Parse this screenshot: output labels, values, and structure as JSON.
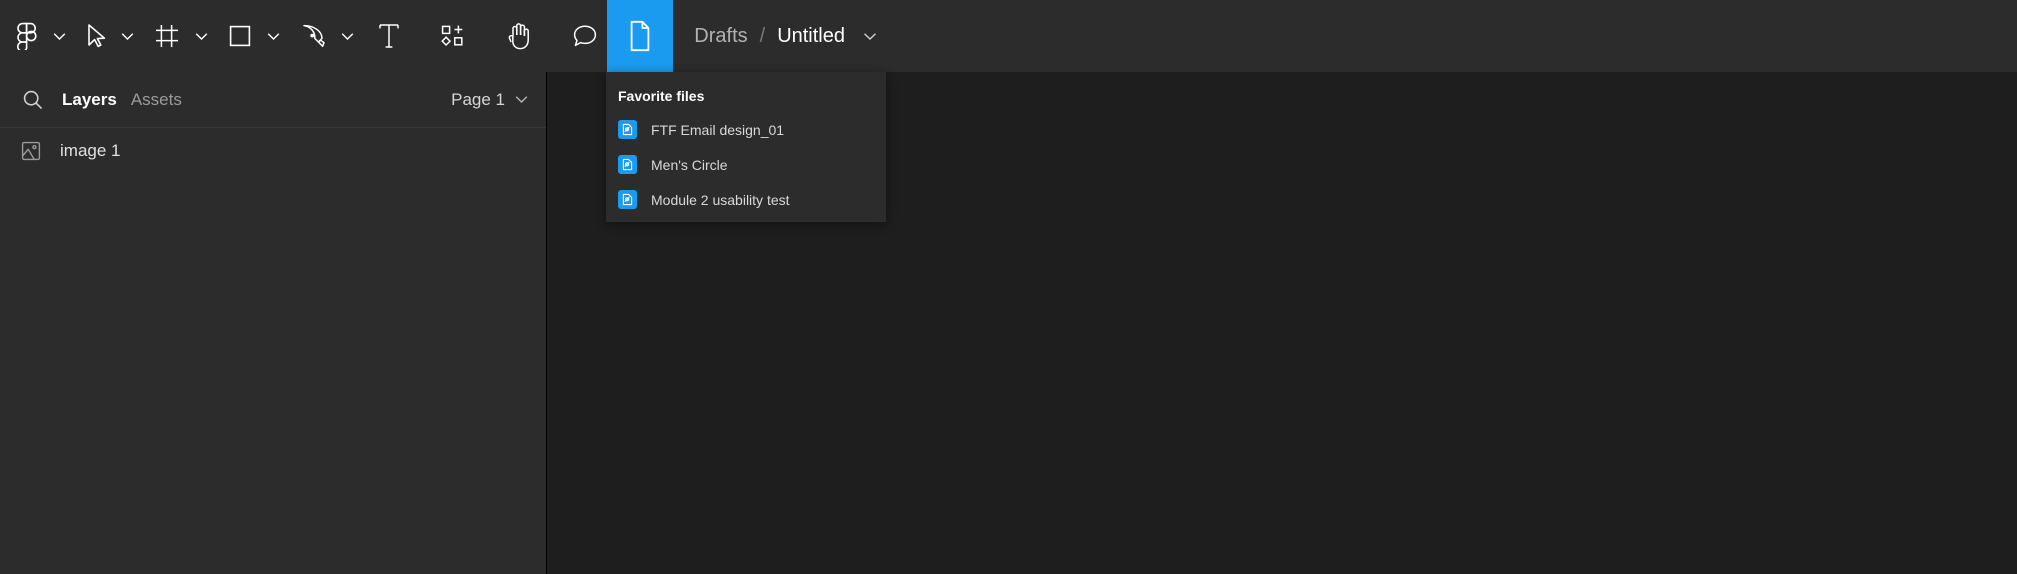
{
  "app": {
    "name": "Figma",
    "accent_blue": "#1b9bf0",
    "toolbar_bg": "#2c2c2c",
    "canvas_bg": "#1e1e1e"
  },
  "toolbar": {
    "tools": [
      {
        "name": "figma-logo-icon",
        "label": "Figma menu",
        "has_caret": true
      },
      {
        "name": "move-cursor-icon",
        "label": "Move",
        "has_caret": true
      },
      {
        "name": "frame-icon",
        "label": "Frame",
        "has_caret": true
      },
      {
        "name": "rectangle-icon",
        "label": "Rectangle",
        "has_caret": true
      },
      {
        "name": "pen-icon",
        "label": "Pen",
        "has_caret": true
      },
      {
        "name": "text-icon",
        "label": "Text",
        "has_caret": false
      },
      {
        "name": "components-icon",
        "label": "Components",
        "has_caret": false
      },
      {
        "name": "hand-icon",
        "label": "Hand",
        "has_caret": false
      },
      {
        "name": "comment-icon",
        "label": "Comment",
        "has_caret": false
      }
    ],
    "file_tab": {
      "name": "file-icon",
      "label": "Files",
      "active": true
    }
  },
  "breadcrumb": {
    "project": "Drafts",
    "separator": "/",
    "file_name": "Untitled"
  },
  "sidebar": {
    "search_placeholder": "Search",
    "tabs": [
      {
        "label": "Layers",
        "active": true
      },
      {
        "label": "Assets",
        "active": false
      }
    ],
    "page_selector": "Page 1",
    "layers": [
      {
        "label": "image 1",
        "icon": "image-icon"
      }
    ]
  },
  "dropdown": {
    "title": "Favorite files",
    "items": [
      {
        "label": "FTF Email design_01"
      },
      {
        "label": "Men's Circle"
      },
      {
        "label": "Module 2 usability test"
      }
    ]
  }
}
